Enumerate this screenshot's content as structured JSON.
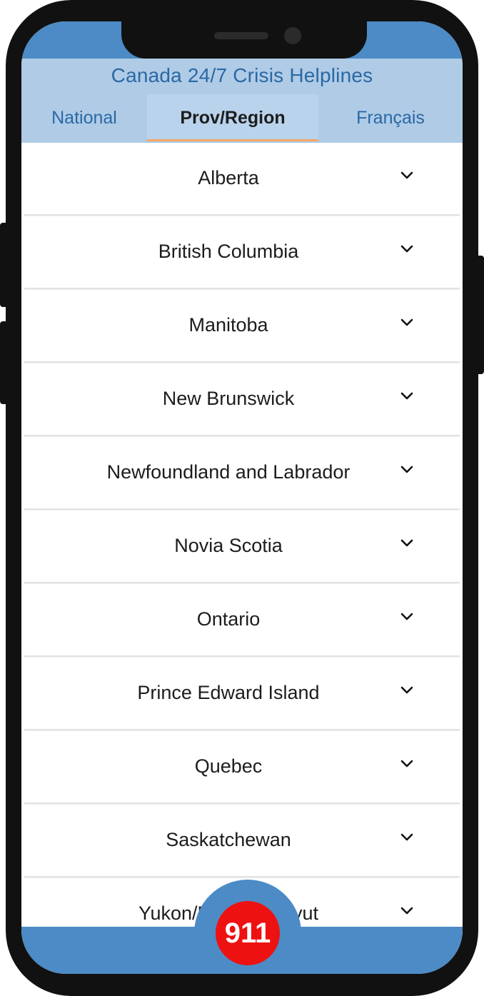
{
  "app": {
    "title": "Canada 24/7 Crisis Helplines"
  },
  "tabs": [
    {
      "label": "National",
      "active": false
    },
    {
      "label": "Prov/Region",
      "active": true
    },
    {
      "label": "Français",
      "active": false
    }
  ],
  "regions": [
    {
      "label": "Alberta",
      "icon": "chevron-down-icon"
    },
    {
      "label": "British Columbia",
      "icon": "chevron-down-icon"
    },
    {
      "label": "Manitoba",
      "icon": "chevron-down-icon"
    },
    {
      "label": "New Brunswick",
      "icon": "chevron-down-icon"
    },
    {
      "label": "Newfoundland and Labrador",
      "icon": "chevron-down-icon"
    },
    {
      "label": "Novia Scotia",
      "icon": "chevron-down-icon"
    },
    {
      "label": "Ontario",
      "icon": "chevron-down-icon"
    },
    {
      "label": "Prince Edward Island",
      "icon": "chevron-down-icon"
    },
    {
      "label": "Quebec",
      "icon": "chevron-down-icon"
    },
    {
      "label": "Saskatchewan",
      "icon": "chevron-down-icon"
    },
    {
      "label": "Yukon/NWT/Nunavut",
      "icon": "chevron-down-icon"
    }
  ],
  "emergency": {
    "label": "911"
  },
  "colors": {
    "accent": "#4c8bc5",
    "header_bg": "#afcbe6",
    "title_text": "#2b68a4",
    "tab_indicator": "#f6a866",
    "emergency": "#ee1111"
  }
}
